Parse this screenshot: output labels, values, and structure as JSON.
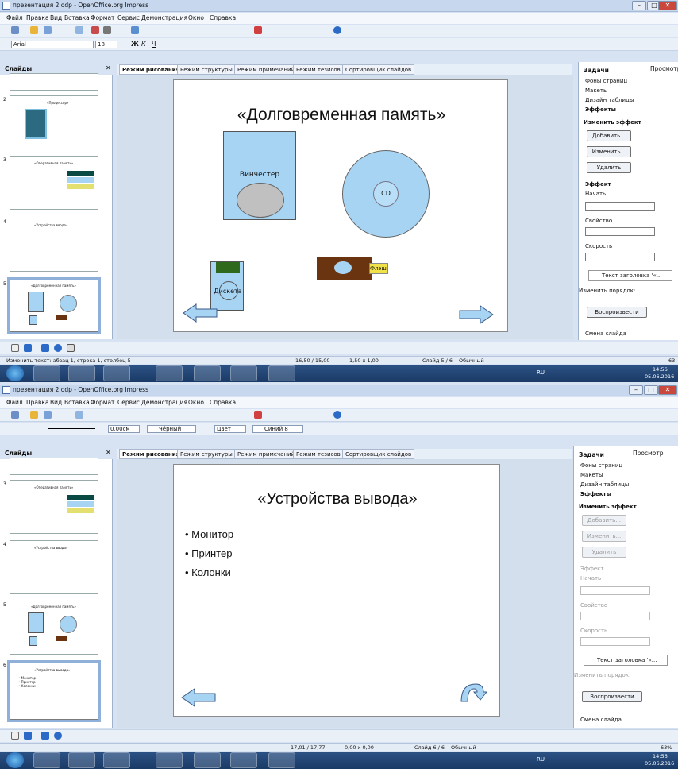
{
  "app_title": "презентация 2.odp - OpenOffice.org Impress",
  "menu": [
    "Файл",
    "Правка",
    "Вид",
    "Вставка",
    "Формат",
    "Сервис",
    "Демонстрация",
    "Окно",
    "Справка"
  ],
  "tabs": [
    "Режим рисования",
    "Режим структуры",
    "Режим примечаний",
    "Режим тезисов",
    "Сортировщик слайдов"
  ],
  "slides_pane_title": "Слайды",
  "tasks": {
    "title": "Задачи",
    "view": "Просмотр",
    "items": [
      "Фоны страниц",
      "Макеты",
      "Дизайн таблицы",
      "Эффекты"
    ],
    "change_effect": "Изменить эффект",
    "add": "Добавить...",
    "change": "Изменить...",
    "delete": "Удалить",
    "effect": "Эффект",
    "start": "Начать",
    "property": "Свойство",
    "speed": "Скорость",
    "effect_item": "Текст заголовка '«...",
    "order": "Изменить порядок:",
    "play": "Воспроизвести",
    "transition": "Смена слайда"
  },
  "thumbs": {
    "t2": "«Процессор»",
    "t3": "«Оперативная память»",
    "t4": "«Устройства ввода»",
    "t5": "«Долговременная память»",
    "t6": "«Устройства вывода»",
    "t6_items": [
      "• Монитор",
      "• Принтер",
      "• Колонки"
    ]
  },
  "w1": {
    "font": "Arial",
    "size": "18",
    "slide_title": "«Долговременная память»",
    "hdd": "Винчестер",
    "cd": "CD",
    "floppy": "Дискета",
    "flash": "Флэш",
    "status_left": "Изменить текст: абзац 1, строка 1, столбец 5",
    "status_pos": "16,50 / 15,00",
    "status_size": "1,50 x 1,00",
    "status_slide": "Слайд 5 / 6",
    "status_layout": "Обычный",
    "zoom": "63"
  },
  "w2": {
    "line_width": "0,00см",
    "line_color": "Чёрный",
    "fill_type": "Цвет",
    "fill_color": "Синий 8",
    "slide_title": "«Устройства вывода»",
    "bullets": [
      "Монитор",
      "Принтер",
      "Колонки"
    ],
    "status_pos": "17,01 / 17,77",
    "status_size": "0,00 x 0,00",
    "status_slide": "Слайд 6 / 6",
    "status_layout": "Обычный",
    "zoom": "63%"
  },
  "clock": {
    "time": "14:56",
    "date": "05.06.2016"
  },
  "lang": "RU",
  "colors": {
    "accent": "#a8d4f4",
    "slide_bg": "#ffffff",
    "taskbar": "#1a3a66"
  }
}
